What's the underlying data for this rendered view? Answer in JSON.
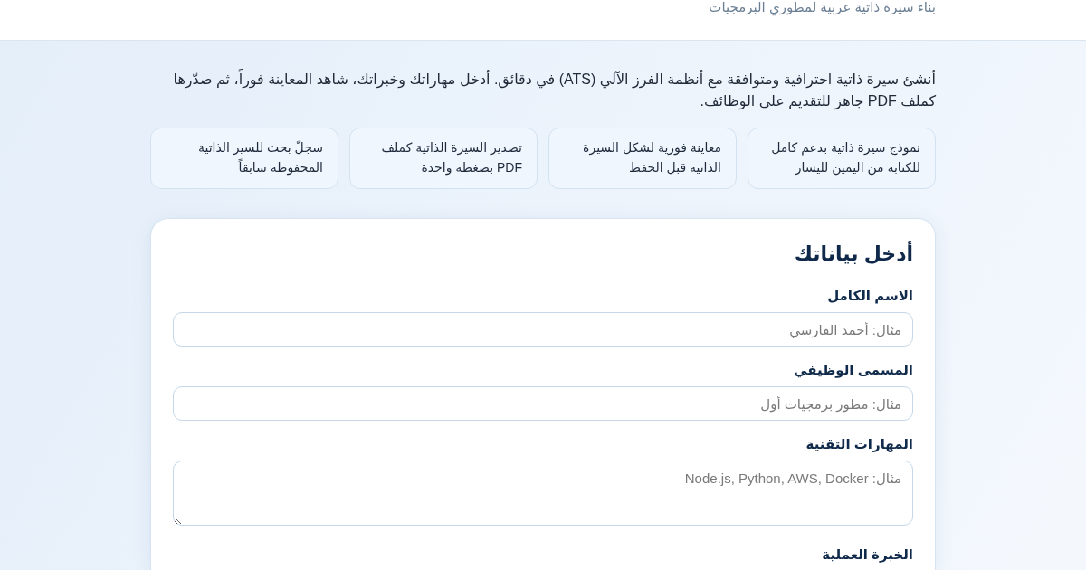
{
  "header": {
    "subtitle": "بناء سيرة ذاتية عربية لمطوري البرمجيات"
  },
  "intro": "أنشئ سيرة ذاتية احترافية ومتوافقة مع أنظمة الفرز الآلي (ATS) في دقائق. أدخل مهاراتك وخبراتك، شاهد المعاينة فوراً، ثم صدّرها كملف PDF جاهز للتقديم على الوظائف.",
  "features": [
    "نموذج سيرة ذاتية بدعم كامل للكتابة من اليمين لليسار",
    "معاينة فورية لشكل السيرة الذاتية قبل الحفظ",
    "تصدير السيرة الذاتية كملف PDF بضغطة واحدة",
    "سجلّ بحث للسير الذاتية المحفوظة سابقاً"
  ],
  "form": {
    "title": "أدخل بياناتك",
    "fields": [
      {
        "label": "الاسم الكامل",
        "kind": "input",
        "placeholder": "مثال: أحمد الفارسي"
      },
      {
        "label": "المسمى الوظيفي",
        "kind": "input",
        "placeholder": "مثال: مطور برمجيات أول"
      },
      {
        "label": "المهارات التقنية",
        "kind": "textarea",
        "placeholder": "مثال: Node.js, Python, AWS, Docker"
      },
      {
        "label": "الخبرة العملية"
      }
    ]
  }
}
